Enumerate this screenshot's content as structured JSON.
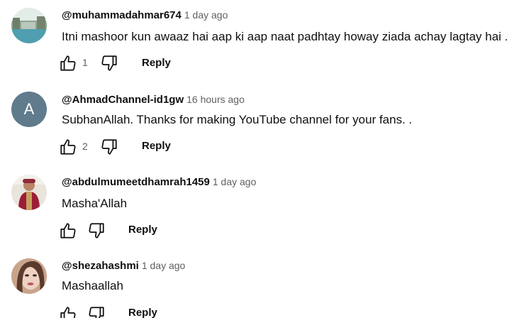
{
  "comments": [
    {
      "author": "@muhammadahmar674",
      "time": "1 day ago",
      "text": "Itni mashoor kun awaaz hai aap ki aap naat padhtay howay  ziada achay lagtay hai .",
      "likes": "1",
      "reply_label": "Reply",
      "avatar": "photo-icon"
    },
    {
      "author": "@AhmadChannel-id1gw",
      "time": "16 hours ago",
      "text": "SubhanAllah. Thanks for making YouTube channel for your fans. .",
      "likes": "2",
      "reply_label": "Reply",
      "avatar_letter": "A",
      "avatar_color": "#5f7b8c"
    },
    {
      "author": "@abdulmumeetdhamrah1459",
      "time": "1 day ago",
      "text": "Masha'Allah",
      "likes": "",
      "reply_label": "Reply",
      "avatar": "photo-icon"
    },
    {
      "author": "@shezahashmi",
      "time": "1 day ago",
      "text": "Mashaallah",
      "likes": "",
      "reply_label": "Reply",
      "avatar": "photo-icon"
    }
  ]
}
